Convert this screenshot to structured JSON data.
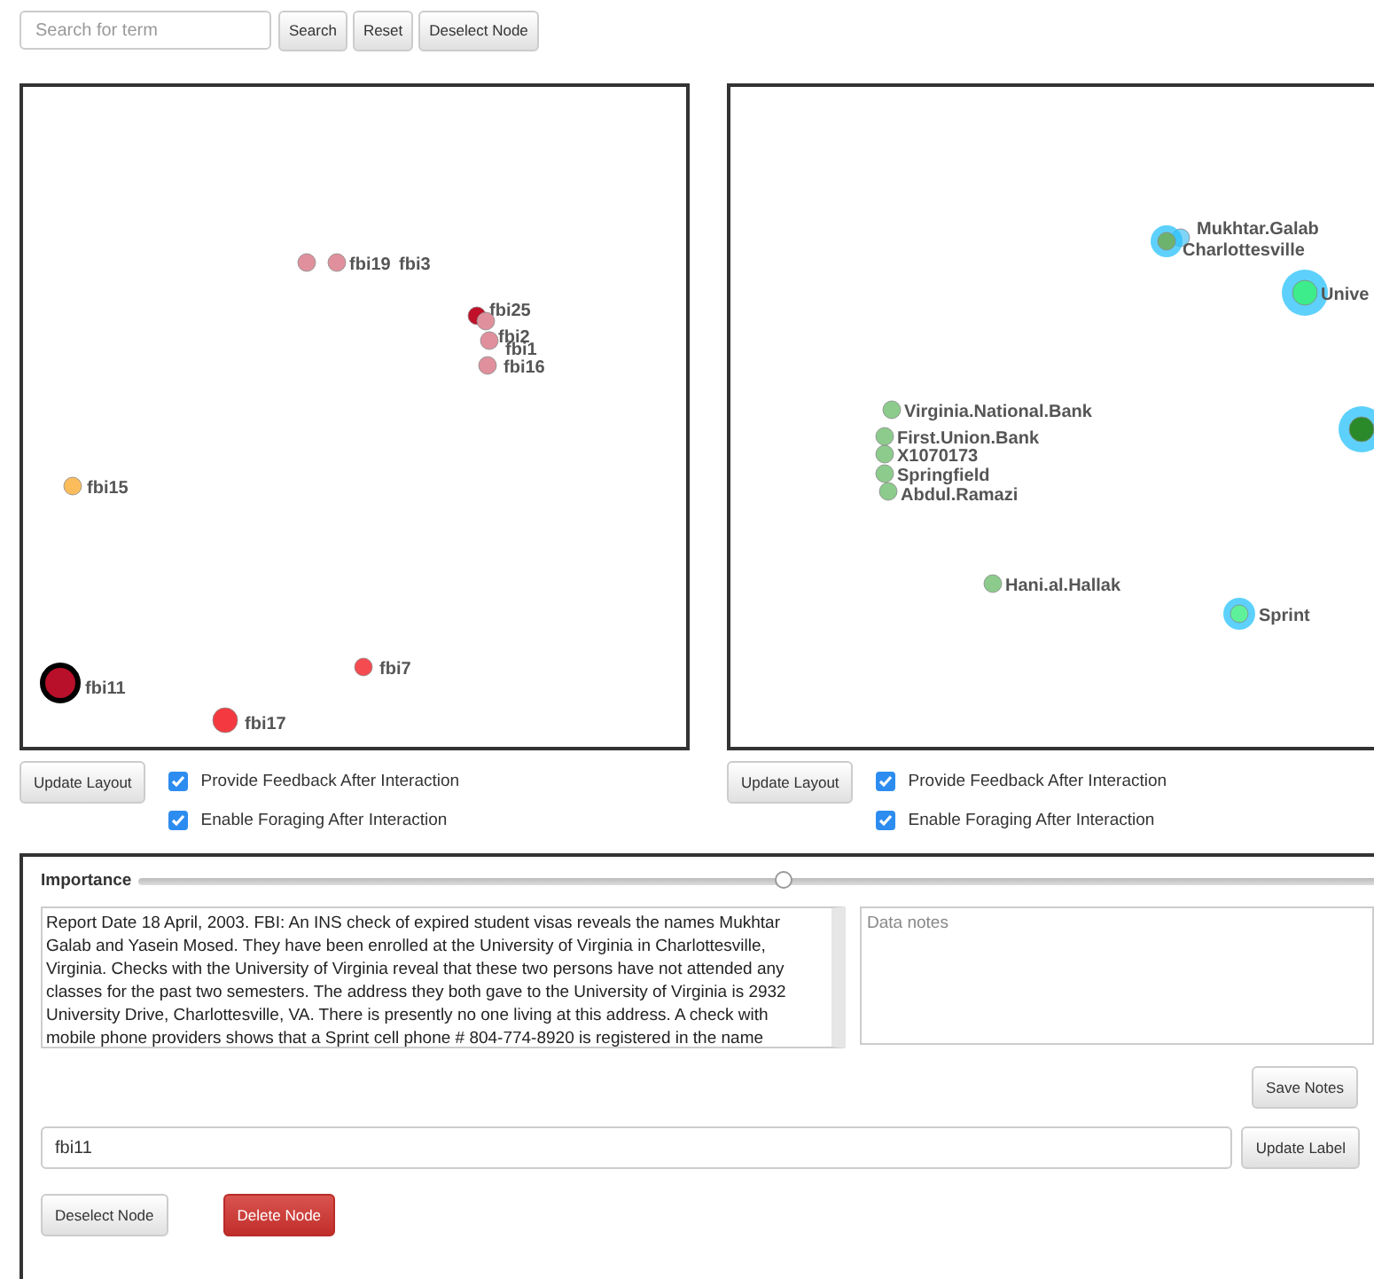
{
  "search": {
    "placeholder": "Search for term"
  },
  "top_buttons": [
    "Search",
    "Reset",
    "Deselect Node"
  ],
  "graphs": [
    {
      "nodes": [
        {
          "label": "fbi19",
          "color": "#e0909c",
          "kind": "small",
          "selected": false
        },
        {
          "label": "fbi3",
          "color": "#e0909c",
          "kind": "small",
          "selected": false
        },
        {
          "label": "fbi25",
          "color": "#c0102a",
          "kind": "small",
          "selected": false
        },
        {
          "label": "fbi2",
          "color": "#e0909c",
          "kind": "small",
          "selected": false
        },
        {
          "label": "fbi1",
          "color": "#e0909c",
          "kind": "small",
          "selected": false
        },
        {
          "label": "fbi16",
          "color": "#e0909c",
          "kind": "small",
          "selected": false
        },
        {
          "label": "fbi15",
          "color": "#fbbd5c",
          "kind": "small",
          "selected": false
        },
        {
          "label": "fbi11",
          "color": "#b8102a",
          "kind": "large",
          "selected": true
        },
        {
          "label": "fbi7",
          "color": "#f44b50",
          "kind": "small",
          "selected": false
        },
        {
          "label": "fbi17",
          "color": "#f43a40",
          "kind": "medium",
          "selected": false
        }
      ],
      "update_button": "Update Layout",
      "options": [
        {
          "label": "Provide Feedback After Interaction",
          "checked": true
        },
        {
          "label": "Enable Foraging After Interaction",
          "checked": true
        }
      ]
    },
    {
      "nodes": [
        {
          "label": "Mukhtar.Galab",
          "color": "#7fd4f7",
          "kind": "small",
          "selected": false
        },
        {
          "label": "Charlottesville",
          "color": "#6db36d",
          "kind": "halo",
          "selected": false
        },
        {
          "label": "Unive",
          "color": "#3dec8a",
          "kind": "big-halo",
          "selected": false
        },
        {
          "color": "#2a8a2a",
          "kind": "big-halo",
          "selected": false
        },
        {
          "label": "Virginia.National.Bank",
          "color": "#8ccb8c",
          "kind": "small",
          "selected": false
        },
        {
          "label": "First.Union.Bank",
          "color": "#8ccb8c",
          "kind": "small",
          "selected": false
        },
        {
          "label": "X1070173",
          "color": "#8ccb8c",
          "kind": "small",
          "selected": false
        },
        {
          "label": "Springfield",
          "color": "#8ccb8c",
          "kind": "small",
          "selected": false
        },
        {
          "label": "Abdul.Ramazi",
          "color": "#8ccb8c",
          "kind": "small",
          "selected": false
        },
        {
          "label": "Hani.al.Hallak",
          "color": "#8ccb8c",
          "kind": "small",
          "selected": false
        },
        {
          "label": "Sprint",
          "color": "#5ef19a",
          "kind": "halo",
          "selected": false
        }
      ],
      "update_button": "Update Layout",
      "options": [
        {
          "label": "Provide Feedback After Interaction",
          "checked": true
        },
        {
          "label": "Enable Foraging After Interaction",
          "checked": true
        }
      ]
    }
  ],
  "details": {
    "importance_label": "Importance",
    "importance": {
      "level": 0.51
    },
    "report": "Report Date 18 April, 2003. FBI: An INS check of expired student visas reveals the names Mukhtar Galab and Yasein Mosed. They have been enrolled at the University of Virginia in Charlottesville, Virginia. Checks with the University of Virginia reveal that these two persons have not attended any classes for the past two semesters. The address they both gave to the University of Virginia is 2932 University Drive, Charlottesville, VA. There is presently no one living at this address. A check with mobile phone providers shows that a Sprint cell phone # 804-774-8920 is registered in the name",
    "notes": {
      "placeholder": "Data notes"
    },
    "save_button": "Save Notes",
    "label_value": "fbi11",
    "update_label_button": "Update Label",
    "deselect_button": "Deselect Node",
    "delete_button": "Delete Node"
  }
}
